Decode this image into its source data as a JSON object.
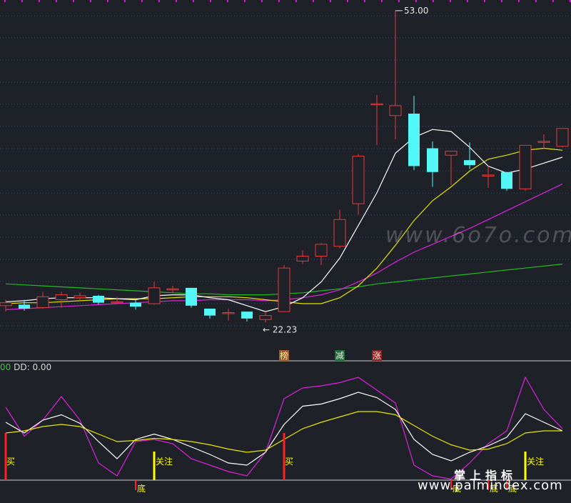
{
  "readout": {
    "lead": "00",
    "main": "DD: 0.00"
  },
  "watermark": {
    "main": "www.6o7o.com",
    "cn": "掌上指标",
    "url": "www.palmindex.com"
  },
  "colors": {
    "background": "#1e2127",
    "up": "#e83a3a",
    "down": "#54f7f7",
    "ma5": "#ffffff",
    "ma10": "#e6e600",
    "ma20": "#dd22dd",
    "ma60": "#22bb22"
  },
  "chart_data": [
    {
      "type": "candlestick",
      "title": "",
      "y_range": [
        19,
        53.5
      ],
      "grid": "horizontal dotted",
      "annotations": {
        "high_label": "53.00",
        "low_label": "22.23"
      },
      "candles": [
        {
          "o": 23.2,
          "h": 23.8,
          "l": 22.6,
          "c": 23.5
        },
        {
          "o": 23.3,
          "h": 23.8,
          "l": 22.7,
          "c": 22.9
        },
        {
          "o": 23.0,
          "h": 24.6,
          "l": 22.9,
          "c": 24.1
        },
        {
          "o": 23.8,
          "h": 24.6,
          "l": 23.0,
          "c": 24.3
        },
        {
          "o": 24.0,
          "h": 24.5,
          "l": 23.6,
          "c": 24.2
        },
        {
          "o": 24.2,
          "h": 24.3,
          "l": 23.3,
          "c": 23.5
        },
        {
          "o": 23.6,
          "h": 24.1,
          "l": 23.4,
          "c": 23.6
        },
        {
          "o": 23.5,
          "h": 23.8,
          "l": 22.8,
          "c": 23.1
        },
        {
          "o": 23.4,
          "h": 25.6,
          "l": 23.3,
          "c": 25.0
        },
        {
          "o": 24.9,
          "h": 25.2,
          "l": 24.5,
          "c": 24.9
        },
        {
          "o": 25.0,
          "h": 25.0,
          "l": 23.0,
          "c": 23.2
        },
        {
          "o": 22.9,
          "h": 22.9,
          "l": 21.9,
          "c": 22.2
        },
        {
          "o": 22.4,
          "h": 22.9,
          "l": 21.7,
          "c": 22.5
        },
        {
          "o": 22.6,
          "h": 22.6,
          "l": 21.6,
          "c": 21.9
        },
        {
          "o": 21.8,
          "h": 22.6,
          "l": 21.5,
          "c": 22.2
        },
        {
          "o": 22.6,
          "h": 27.3,
          "l": 22.6,
          "c": 27.0
        },
        {
          "o": 27.7,
          "h": 28.8,
          "l": 27.4,
          "c": 28.2
        },
        {
          "o": 28.2,
          "h": 29.5,
          "l": 27.3,
          "c": 29.4
        },
        {
          "o": 29.2,
          "h": 32.9,
          "l": 29.0,
          "c": 31.9
        },
        {
          "o": 33.5,
          "h": 38.5,
          "l": 32.4,
          "c": 38.3
        },
        {
          "o": 43.6,
          "h": 44.5,
          "l": 39.4,
          "c": 43.6
        },
        {
          "o": 42.4,
          "h": 53.0,
          "l": 40.0,
          "c": 43.4
        },
        {
          "o": 42.6,
          "h": 44.4,
          "l": 36.9,
          "c": 37.3
        },
        {
          "o": 39.1,
          "h": 39.8,
          "l": 35.2,
          "c": 36.7
        },
        {
          "o": 38.4,
          "h": 38.8,
          "l": 35.4,
          "c": 38.8
        },
        {
          "o": 37.9,
          "h": 39.7,
          "l": 37.0,
          "c": 37.4
        },
        {
          "o": 36.4,
          "h": 37.3,
          "l": 35.1,
          "c": 36.4
        },
        {
          "o": 36.7,
          "h": 36.7,
          "l": 34.8,
          "c": 35.0
        },
        {
          "o": 35.0,
          "h": 39.4,
          "l": 34.8,
          "c": 39.4
        },
        {
          "o": 39.7,
          "h": 40.5,
          "l": 39.0,
          "c": 39.8
        },
        {
          "o": 39.3,
          "h": 41.1,
          "l": 39.2,
          "c": 41.1
        }
      ],
      "ma5": [
        23.6,
        23.7,
        23.9,
        24.0,
        24.0,
        24.0,
        23.9,
        23.8,
        24.2,
        24.3,
        24.3,
        24.0,
        23.8,
        23.2,
        22.6,
        23.1,
        24.0,
        25.6,
        28.0,
        31.3,
        34.6,
        38.6,
        40.2,
        41.0,
        40.8,
        39.2,
        37.3,
        36.6,
        37.0,
        37.6,
        38.2
      ],
      "ma10": [
        23.4,
        23.5,
        23.5,
        23.6,
        23.7,
        23.8,
        23.9,
        23.9,
        23.9,
        24.0,
        24.1,
        24.1,
        24.1,
        24.0,
        23.8,
        23.6,
        23.4,
        23.4,
        24.0,
        25.2,
        27.0,
        29.3,
        31.8,
        33.8,
        35.2,
        36.8,
        38.0,
        38.4,
        38.9,
        39.1,
        38.9
      ],
      "ma20": [
        22.8,
        22.9,
        23.0,
        23.1,
        23.2,
        23.3,
        23.4,
        23.5,
        23.6,
        23.7,
        23.7,
        23.8,
        23.8,
        23.8,
        23.7,
        23.8,
        24.0,
        24.3,
        24.8,
        25.6,
        26.5,
        27.6,
        28.6,
        29.4,
        30.2,
        31.0,
        31.9,
        32.8,
        33.7,
        34.6,
        35.5
      ],
      "ma60": [
        25.4,
        25.3,
        25.2,
        25.1,
        25.0,
        24.9,
        24.8,
        24.7,
        24.6,
        24.5,
        24.4,
        24.4,
        24.3,
        24.3,
        24.3,
        24.4,
        24.5,
        24.7,
        24.9,
        25.1,
        25.4,
        25.6,
        25.8,
        26.0,
        26.2,
        26.4,
        26.6,
        26.8,
        27.0,
        27.2,
        27.4
      ],
      "labels": [
        {
          "index": 15,
          "text": "榜",
          "bg": "#a05a2a",
          "fg": "#e8e8a0"
        },
        {
          "index": 18,
          "text": "减",
          "bg": "#1e6b3a",
          "fg": "#e8e8e8"
        },
        {
          "index": 20,
          "text": "涨",
          "bg": "#8a2222",
          "fg": "#e8e8e8"
        }
      ]
    },
    {
      "type": "line",
      "title": "DD",
      "y_range": [
        -8,
        100
      ],
      "series": [
        {
          "name": "",
          "color": "#dd22dd",
          "values": [
            72,
            45,
            60,
            82,
            60,
            20,
            8,
            40,
            42,
            38,
            24,
            18,
            12,
            8,
            30,
            80,
            90,
            92,
            95,
            100,
            88,
            76,
            18,
            8,
            5,
            20,
            38,
            50,
            100,
            70,
            52
          ]
        },
        {
          "name": "",
          "color": "#ffffff",
          "values": [
            58,
            48,
            60,
            65,
            57,
            40,
            24,
            42,
            47,
            42,
            35,
            28,
            20,
            18,
            30,
            56,
            73,
            75,
            80,
            86,
            81,
            70,
            42,
            28,
            22,
            30,
            36,
            44,
            66,
            58,
            50
          ]
        },
        {
          "name": "",
          "color": "#e6e600",
          "values": [
            48,
            50,
            54,
            56,
            54,
            47,
            40,
            41,
            43,
            42,
            40,
            37,
            33,
            30,
            32,
            42,
            52,
            58,
            63,
            68,
            68,
            65,
            55,
            45,
            37,
            32,
            33,
            38,
            48,
            50,
            50
          ]
        }
      ],
      "buy_markers": [
        {
          "index": 0,
          "text": "买",
          "bar_color": "#ff2020",
          "text_color": "#ffff00"
        },
        {
          "index": 15,
          "text": "买",
          "bar_color": "#ff2020",
          "text_color": "#ffff00"
        }
      ],
      "watch_markers": [
        {
          "index": 8,
          "text": "关注",
          "bar_color": "#ffff00",
          "text_color": "#ffff00"
        },
        {
          "index": 28,
          "text": "关注",
          "bar_color": "#ffff00",
          "text_color": "#ffff00"
        }
      ],
      "bottom_markers": [
        {
          "index": 7,
          "text": "底"
        },
        {
          "index": 24,
          "text": "底"
        },
        {
          "index": 26,
          "text": "底"
        },
        {
          "index": 27,
          "text": "底"
        }
      ]
    }
  ]
}
